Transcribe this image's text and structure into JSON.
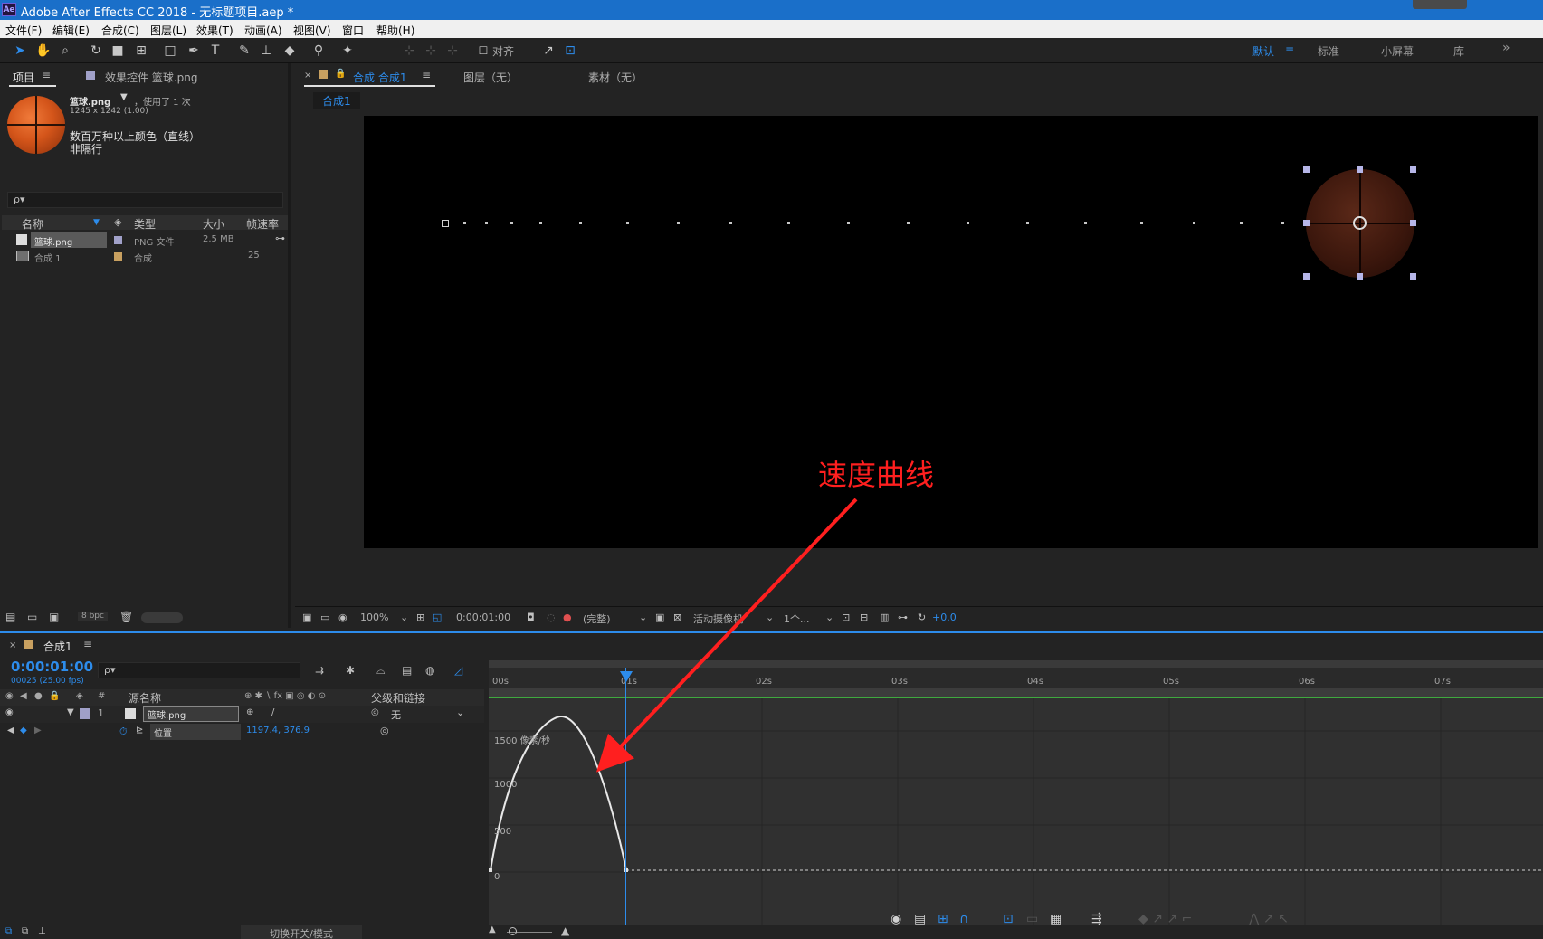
{
  "app": {
    "logo": "Ae",
    "title": "Adobe After Effects CC 2018 - 无标题项目.aep *"
  },
  "menu": [
    "文件(F)",
    "编辑(E)",
    "合成(C)",
    "图层(L)",
    "效果(T)",
    "动画(A)",
    "视图(V)",
    "窗口",
    "帮助(H)"
  ],
  "toolbar": {
    "align_label": "对齐",
    "workspaces": [
      "默认",
      "标准",
      "小屏幕",
      "库"
    ],
    "active_workspace": "默认"
  },
  "project_panel": {
    "tab_project": "项目",
    "tab_effects": "效果控件 篮球.png",
    "asset": {
      "name": "篮球.png",
      "usage": "，使用了 1 次",
      "dimensions": "1245 x 1242 (1.00)",
      "color_info": "数百万种以上颜色（直线）",
      "interlace": "非隔行"
    },
    "search_placeholder": "ρ▾",
    "columns": [
      "名称",
      "类型",
      "大小",
      "帧速率"
    ],
    "items": [
      {
        "name": "篮球.png",
        "type": "PNG 文件",
        "size": "2.5 MB",
        "fps": ""
      },
      {
        "name": "合成 1",
        "type": "合成",
        "size": "",
        "fps": "25"
      }
    ],
    "bpc": "8 bpc"
  },
  "comp_panel": {
    "tab_comp": "合成 合成1",
    "tab_layer": "图层（无）",
    "tab_footage": "素材（无）",
    "breadcrumb": "合成1",
    "zoom": "100%",
    "timecode": "0:00:01:00",
    "resolution": "(完整)",
    "camera": "活动摄像机",
    "views": "1个...",
    "exposure": "+0.0"
  },
  "timeline": {
    "tab": "合成1",
    "timecode": "0:00:01:00",
    "frame_info": "00025 (25.00 fps)",
    "col_source": "源名称",
    "col_parent": "父级和链接",
    "layer": {
      "index": "1",
      "name": "篮球.png",
      "parent": "无",
      "property": "位置",
      "value": "1197.4, 376.9"
    },
    "ruler_ticks": [
      "00s",
      "01s",
      "02s",
      "03s",
      "04s",
      "05s",
      "06s",
      "07s"
    ],
    "graph_unit": "1500 像素/秒",
    "graph_labels": [
      "1000",
      "500",
      "0"
    ],
    "bottom_toggle": "切换开关/模式"
  },
  "annotation": {
    "text": "速度曲线",
    "color": "#ff1f1f"
  },
  "colors": {
    "accent": "#2d8ceb",
    "titlebar": "#1a6fc9"
  }
}
